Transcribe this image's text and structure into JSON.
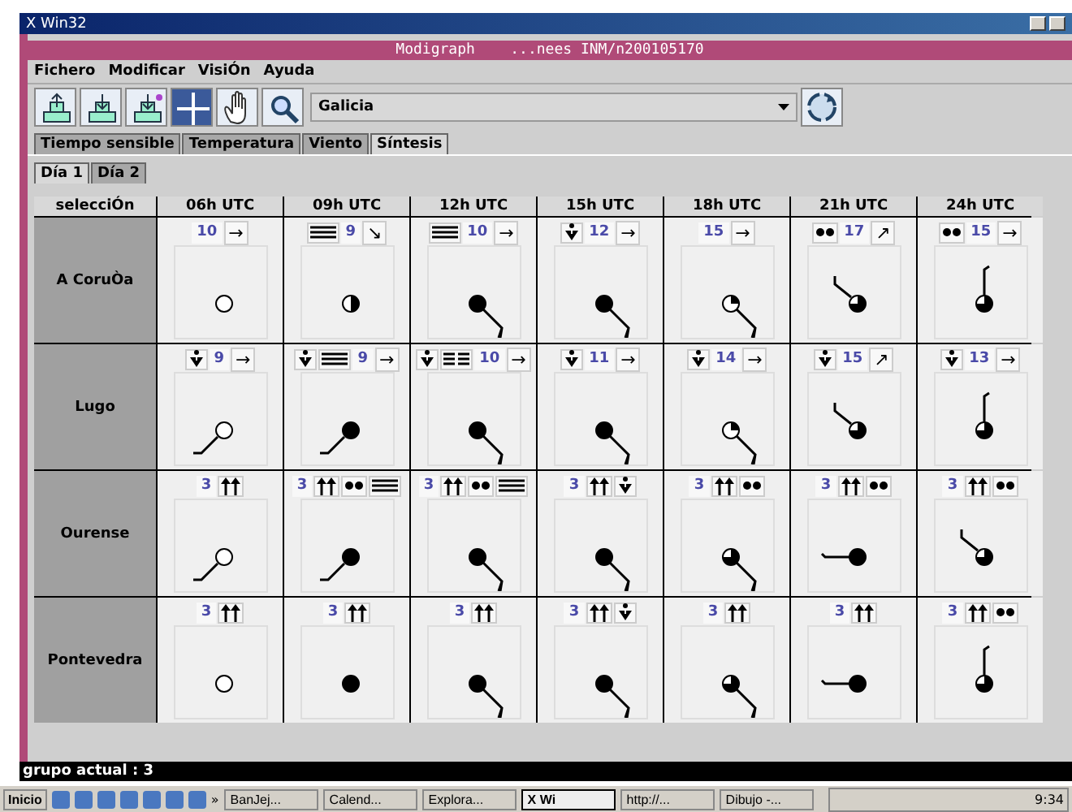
{
  "outer_window": {
    "title": "X Win32"
  },
  "window": {
    "title": "Modigraph    ...nees INM/n200105170"
  },
  "menu": [
    "Fichero",
    "Modificar",
    "VisiÓn",
    "Ayuda"
  ],
  "toolbar": {
    "region": "Galicia"
  },
  "tabs": [
    {
      "label": "Tiempo sensible",
      "selected": false
    },
    {
      "label": "Temperatura",
      "selected": false
    },
    {
      "label": "Viento",
      "selected": false
    },
    {
      "label": "Síntesis",
      "selected": true
    }
  ],
  "day_tabs": [
    {
      "label": "Día 1",
      "selected": true
    },
    {
      "label": "Día 2",
      "selected": false
    }
  ],
  "table": {
    "corner": "selecciÓn",
    "columns": [
      "06h UTC",
      "09h UTC",
      "12h UTC",
      "15h UTC",
      "18h UTC",
      "21h UTC",
      "24h UTC"
    ],
    "rows": [
      {
        "name": "A CoruÒa",
        "cells": [
          {
            "badges": [
              {
                "kind": "number",
                "text": "10"
              },
              {
                "kind": "arrow",
                "text": "→"
              }
            ],
            "cloud": {
              "kind": "clear"
            }
          },
          {
            "badges": [
              {
                "kind": "fog"
              },
              {
                "kind": "number",
                "text": "9"
              },
              {
                "kind": "arrow",
                "text": "↘"
              }
            ],
            "cloud": {
              "kind": "half"
            }
          },
          {
            "badges": [
              {
                "kind": "fog"
              },
              {
                "kind": "number",
                "text": "10"
              },
              {
                "kind": "arrow",
                "text": "→"
              }
            ],
            "cloud": {
              "kind": "overcast"
            },
            "wind": {
              "kind": "se"
            }
          },
          {
            "badges": [
              {
                "kind": "shower"
              },
              {
                "kind": "number",
                "text": "12"
              },
              {
                "kind": "arrow",
                "text": "→"
              }
            ],
            "cloud": {
              "kind": "overcast"
            },
            "wind": {
              "kind": "se"
            }
          },
          {
            "badges": [
              {
                "kind": "number",
                "text": "15"
              },
              {
                "kind": "arrow",
                "text": "→"
              }
            ],
            "cloud": {
              "kind": "quarter"
            },
            "wind": {
              "kind": "se"
            }
          },
          {
            "badges": [
              {
                "kind": "drizzle"
              },
              {
                "kind": "number",
                "text": "17"
              },
              {
                "kind": "arrow",
                "text": "↗"
              }
            ],
            "cloud": {
              "kind": "three-quarter"
            },
            "wind": {
              "kind": "nw"
            }
          },
          {
            "badges": [
              {
                "kind": "drizzle"
              },
              {
                "kind": "number",
                "text": "15"
              },
              {
                "kind": "arrow",
                "text": "→"
              }
            ],
            "cloud": {
              "kind": "three-quarter"
            },
            "wind": {
              "kind": "n"
            }
          }
        ]
      },
      {
        "name": "Lugo",
        "cells": [
          {
            "badges": [
              {
                "kind": "shower"
              },
              {
                "kind": "number",
                "text": "9"
              },
              {
                "kind": "arrow",
                "text": "→"
              }
            ],
            "cloud": {
              "kind": "clear"
            },
            "wind": {
              "kind": "sw"
            }
          },
          {
            "badges": [
              {
                "kind": "shower"
              },
              {
                "kind": "fog"
              },
              {
                "kind": "number",
                "text": "9"
              },
              {
                "kind": "arrow",
                "text": "→"
              }
            ],
            "cloud": {
              "kind": "overcast"
            },
            "wind": {
              "kind": "sw"
            }
          },
          {
            "badges": [
              {
                "kind": "shower"
              },
              {
                "kind": "fog-broken"
              },
              {
                "kind": "number",
                "text": "10"
              },
              {
                "kind": "arrow",
                "text": "→"
              }
            ],
            "cloud": {
              "kind": "overcast"
            },
            "wind": {
              "kind": "se"
            }
          },
          {
            "badges": [
              {
                "kind": "shower"
              },
              {
                "kind": "number",
                "text": "11"
              },
              {
                "kind": "arrow",
                "text": "→"
              }
            ],
            "cloud": {
              "kind": "overcast"
            },
            "wind": {
              "kind": "se"
            }
          },
          {
            "badges": [
              {
                "kind": "shower"
              },
              {
                "kind": "number",
                "text": "14"
              },
              {
                "kind": "arrow",
                "text": "→"
              }
            ],
            "cloud": {
              "kind": "quarter"
            },
            "wind": {
              "kind": "se"
            }
          },
          {
            "badges": [
              {
                "kind": "shower"
              },
              {
                "kind": "number",
                "text": "15"
              },
              {
                "kind": "arrow",
                "text": "↗"
              }
            ],
            "cloud": {
              "kind": "three-quarter"
            },
            "wind": {
              "kind": "nw"
            }
          },
          {
            "badges": [
              {
                "kind": "shower"
              },
              {
                "kind": "number",
                "text": "13"
              },
              {
                "kind": "arrow",
                "text": "→"
              }
            ],
            "cloud": {
              "kind": "three-quarter"
            },
            "wind": {
              "kind": "n"
            }
          }
        ]
      },
      {
        "name": "Ourense",
        "cells": [
          {
            "badges": [
              {
                "kind": "number",
                "text": "3"
              },
              {
                "kind": "updraft"
              }
            ],
            "cloud": {
              "kind": "clear"
            },
            "wind": {
              "kind": "sw"
            }
          },
          {
            "badges": [
              {
                "kind": "number",
                "text": "3"
              },
              {
                "kind": "updraft"
              },
              {
                "kind": "drizzle"
              },
              {
                "kind": "fog"
              }
            ],
            "cloud": {
              "kind": "overcast"
            },
            "wind": {
              "kind": "sw"
            }
          },
          {
            "badges": [
              {
                "kind": "number",
                "text": "3"
              },
              {
                "kind": "updraft"
              },
              {
                "kind": "drizzle"
              },
              {
                "kind": "fog"
              }
            ],
            "cloud": {
              "kind": "overcast"
            },
            "wind": {
              "kind": "se"
            }
          },
          {
            "badges": [
              {
                "kind": "number",
                "text": "3"
              },
              {
                "kind": "updraft"
              },
              {
                "kind": "shower"
              }
            ],
            "cloud": {
              "kind": "overcast"
            },
            "wind": {
              "kind": "se"
            }
          },
          {
            "badges": [
              {
                "kind": "number",
                "text": "3"
              },
              {
                "kind": "updraft"
              },
              {
                "kind": "drizzle"
              }
            ],
            "cloud": {
              "kind": "three-quarter"
            },
            "wind": {
              "kind": "se"
            }
          },
          {
            "badges": [
              {
                "kind": "number",
                "text": "3"
              },
              {
                "kind": "updraft"
              },
              {
                "kind": "drizzle"
              }
            ],
            "cloud": {
              "kind": "overcast"
            },
            "wind": {
              "kind": "w"
            }
          },
          {
            "badges": [
              {
                "kind": "number",
                "text": "3"
              },
              {
                "kind": "updraft"
              },
              {
                "kind": "drizzle"
              }
            ],
            "cloud": {
              "kind": "three-quarter"
            },
            "wind": {
              "kind": "nw"
            }
          }
        ]
      },
      {
        "name": "Pontevedra",
        "cells": [
          {
            "badges": [
              {
                "kind": "number",
                "text": "3"
              },
              {
                "kind": "updraft"
              }
            ],
            "cloud": {
              "kind": "clear"
            }
          },
          {
            "badges": [
              {
                "kind": "number",
                "text": "3"
              },
              {
                "kind": "updraft"
              }
            ],
            "cloud": {
              "kind": "overcast"
            }
          },
          {
            "badges": [
              {
                "kind": "number",
                "text": "3"
              },
              {
                "kind": "updraft"
              }
            ],
            "cloud": {
              "kind": "overcast"
            },
            "wind": {
              "kind": "se"
            }
          },
          {
            "badges": [
              {
                "kind": "number",
                "text": "3"
              },
              {
                "kind": "updraft"
              },
              {
                "kind": "shower"
              }
            ],
            "cloud": {
              "kind": "overcast"
            },
            "wind": {
              "kind": "se"
            }
          },
          {
            "badges": [
              {
                "kind": "number",
                "text": "3"
              },
              {
                "kind": "updraft"
              }
            ],
            "cloud": {
              "kind": "three-quarter"
            },
            "wind": {
              "kind": "se"
            }
          },
          {
            "badges": [
              {
                "kind": "number",
                "text": "3"
              },
              {
                "kind": "updraft"
              }
            ],
            "cloud": {
              "kind": "overcast"
            },
            "wind": {
              "kind": "w"
            }
          },
          {
            "badges": [
              {
                "kind": "number",
                "text": "3"
              },
              {
                "kind": "updraft"
              },
              {
                "kind": "drizzle"
              }
            ],
            "cloud": {
              "kind": "three-quarter"
            },
            "wind": {
              "kind": "n"
            }
          }
        ]
      }
    ]
  },
  "status_bar": "grupo actual : 3",
  "taskbar": {
    "start": "Inicio",
    "more": "»",
    "tasks": [
      {
        "label": "BanJej...",
        "selected": false
      },
      {
        "label": "Calend...",
        "selected": false
      },
      {
        "label": "Explora...",
        "selected": false
      },
      {
        "label": "X Wi",
        "selected": true
      },
      {
        "label": "http://...",
        "selected": false
      },
      {
        "label": "Dibujo -...",
        "selected": false
      }
    ],
    "clock": "9:34"
  }
}
